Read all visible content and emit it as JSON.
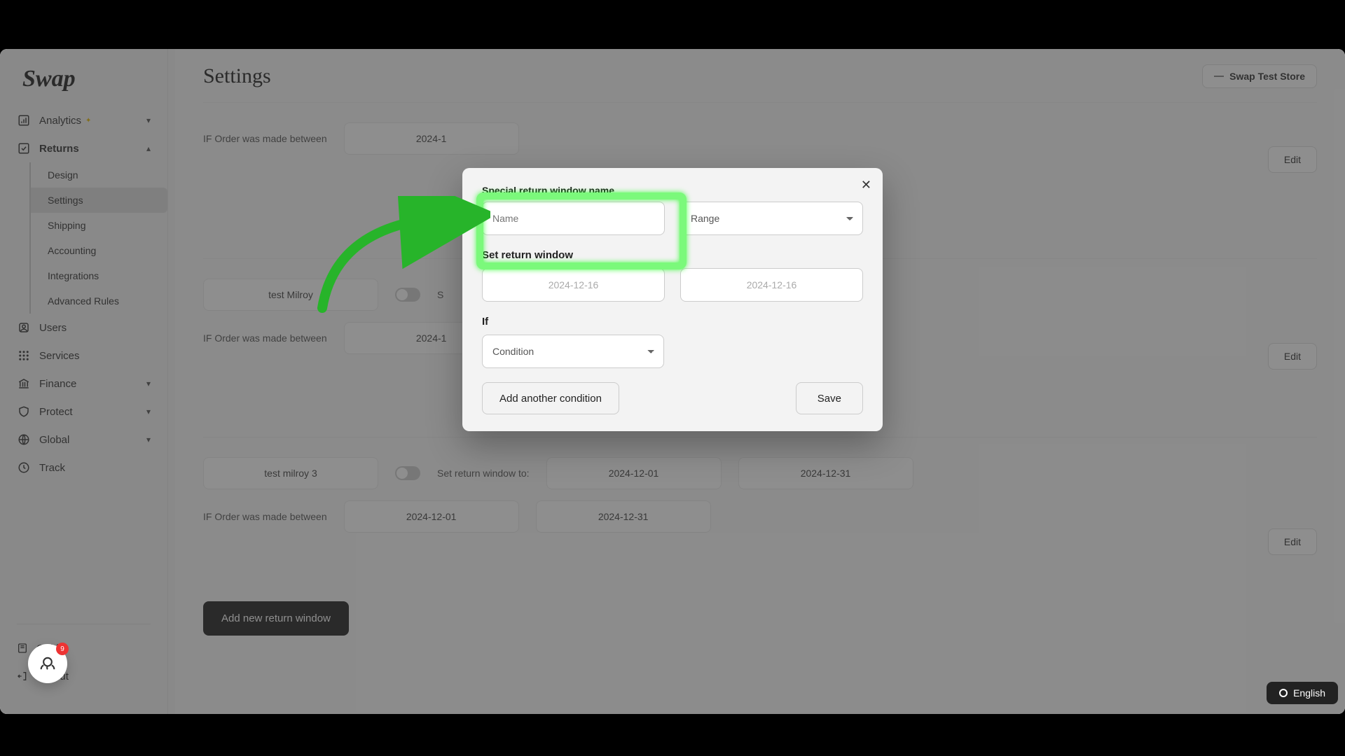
{
  "brand": "Swap",
  "page_title": "Settings",
  "store": {
    "name": "Swap Test Store"
  },
  "sidebar": {
    "items": [
      {
        "label": "Analytics",
        "icon": "chart"
      },
      {
        "label": "Returns",
        "icon": "returns",
        "expanded": true,
        "children": [
          {
            "label": "Design"
          },
          {
            "label": "Settings",
            "active": true
          },
          {
            "label": "Shipping"
          },
          {
            "label": "Accounting"
          },
          {
            "label": "Integrations"
          },
          {
            "label": "Advanced Rules"
          }
        ]
      },
      {
        "label": "Users",
        "icon": "users"
      },
      {
        "label": "Services",
        "icon": "grid"
      },
      {
        "label": "Finance",
        "icon": "bank"
      },
      {
        "label": "Protect",
        "icon": "shield"
      },
      {
        "label": "Global",
        "icon": "globe"
      },
      {
        "label": "Track",
        "icon": "track"
      }
    ],
    "footer": [
      {
        "label": "Guide",
        "icon": "guide"
      },
      {
        "label": "Logout",
        "icon": "logout"
      }
    ]
  },
  "rules": [
    {
      "name_visible": false,
      "if_label": "IF Order was made between",
      "from": "2024-1",
      "edit": "Edit"
    },
    {
      "name": "test Milroy",
      "set_label_prefix": "S",
      "if_label": "IF Order was made between",
      "from": "2024-1",
      "edit": "Edit"
    },
    {
      "name": "test milroy 3",
      "set_label": "Set return window to:",
      "range_from": "2024-12-01",
      "range_to": "2024-12-31",
      "if_label": "IF Order was made between",
      "from": "2024-12-01",
      "to": "2024-12-31",
      "edit": "Edit"
    }
  ],
  "add_button": "Add new return window",
  "modal": {
    "name_label": "Special return window name",
    "name_placeholder": "Name",
    "range_select": "Range",
    "window_label": "Set return window",
    "window_from": "2024-12-16",
    "window_to": "2024-12-16",
    "if_label": "If",
    "condition_placeholder": "Condition",
    "add_condition": "Add another condition",
    "save": "Save"
  },
  "help_badge": "9",
  "language": "English"
}
